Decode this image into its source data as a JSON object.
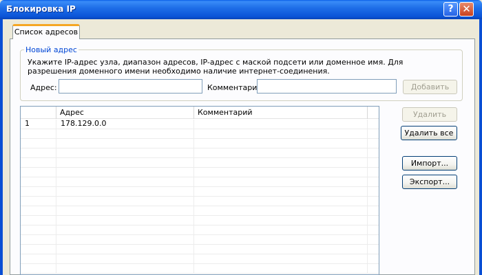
{
  "window": {
    "title": "Блокировка IP",
    "help_glyph": "?",
    "close_glyph": "✕"
  },
  "tabs": [
    {
      "label": "Список адресов",
      "active": true
    }
  ],
  "new_address": {
    "legend": "Новый адрес",
    "hint": "Укажите IP-адрес узла, диапазон адресов, IP-адрес с маской подсети или доменное имя. Для разрешения доменного имени необходимо наличие интернет-соединения.",
    "address_label": "Адрес:",
    "address_value": "",
    "comment_label": "Комментарий",
    "comment_value": "",
    "add_button": "Добавить"
  },
  "table": {
    "columns": [
      "",
      "Адрес",
      "Комментарий"
    ],
    "rows": [
      {
        "num": "1",
        "address": "178.129.0.0",
        "comment": ""
      }
    ]
  },
  "actions": {
    "delete": "Удалить",
    "delete_all": "Удалить все",
    "import": "Импорт...",
    "export": "Экспорт..."
  },
  "colors": {
    "titlebar": "#0b54d8",
    "tab_accent": "#f5a623",
    "legend": "#0046d5"
  }
}
